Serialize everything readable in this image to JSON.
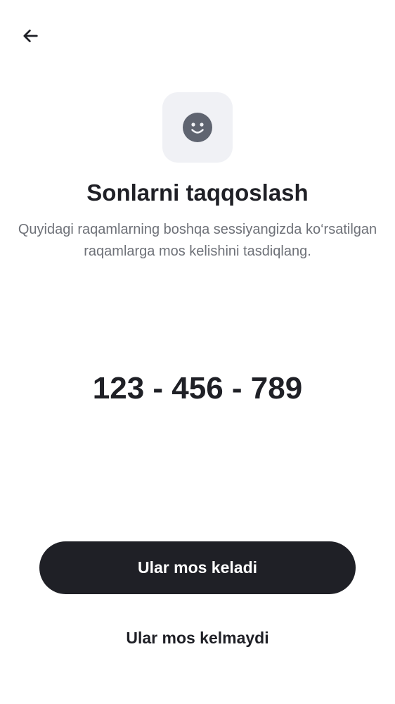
{
  "header": {
    "back_icon": "arrow-left-icon"
  },
  "hero": {
    "icon": "smiley-face-icon",
    "title": "Sonlarni taqqoslash",
    "subtitle": "Quyidagi raqamlarning boshqa sessiyangizda ko‘rsatilgan raqamlarga mos kelishini tasdiqlang."
  },
  "verification": {
    "code": "123 - 456 - 789"
  },
  "actions": {
    "confirm_label": "Ular mos keladi",
    "reject_label": "Ular mos kelmaydi"
  },
  "colors": {
    "primary": "#1f2026",
    "icon_tile_bg": "#f0f1f5",
    "icon": "#5f6470",
    "subtitle_text": "#6e7178"
  }
}
